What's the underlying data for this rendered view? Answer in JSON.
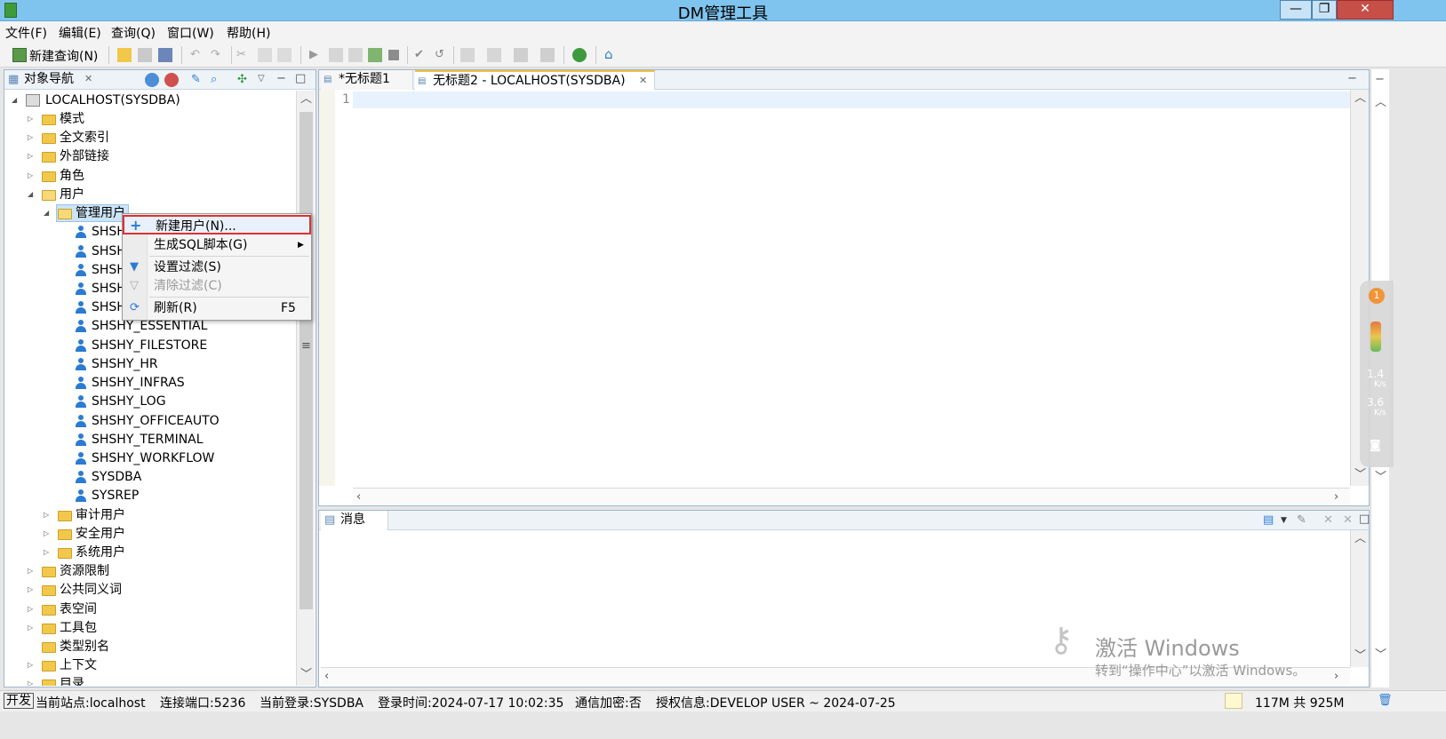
{
  "window": {
    "title": "DM管理工具",
    "minimize": "—",
    "maximize": "❐",
    "close": "✕"
  },
  "menu": [
    "文件(F)",
    "编辑(E)",
    "查询(Q)",
    "窗口(W)",
    "帮助(H)"
  ],
  "toolbar": {
    "new_query": "新建查询(N)"
  },
  "navigator": {
    "tab_label": "对象导航",
    "root": "LOCALHOST(SYSDBA)",
    "schema": "模式",
    "fulltext": "全文索引",
    "external_link": "外部链接",
    "role": "角色",
    "users": "用户",
    "admin_users": "管理用户",
    "user_items": [
      "SHSH",
      "SHSH",
      "SHSH",
      "SHSH",
      "SHSH",
      "SHSHY_ESSENTIAL",
      "SHSHY_FILESTORE",
      "SHSHY_HR",
      "SHSHY_INFRAS",
      "SHSHY_LOG",
      "SHSHY_OFFICEAUTO",
      "SHSHY_TERMINAL",
      "SHSHY_WORKFLOW",
      "SYSDBA",
      "SYSREP"
    ],
    "audit_users": "审计用户",
    "security_users": "安全用户",
    "system_users": "系统用户",
    "resource_limit": "资源限制",
    "public_synonym": "公共同义词",
    "tablespace": "表空间",
    "package": "工具包",
    "type_alias": "类型别名",
    "context": "上下文",
    "directory": "目录"
  },
  "context_menu": {
    "new_user": "新建用户(N)...",
    "gen_sql": "生成SQL脚本(G)",
    "set_filter": "设置过滤(S)",
    "clear_filter": "清除过滤(C)",
    "refresh": "刷新(R)",
    "refresh_key": "F5"
  },
  "editor": {
    "tab1": "*无标题1",
    "tab2": "无标题2 - LOCALHOST(SYSDBA)",
    "line_number": "1"
  },
  "messages": {
    "tab_label": "消息"
  },
  "status": {
    "mode": "开发",
    "site": "当前站点:localhost",
    "port": "连接端口:5236",
    "login": "当前登录:SYSDBA",
    "login_time": "登录时间:2024-07-17 10:02:35",
    "encryption": "通信加密:否",
    "license": "授权信息:DEVELOP USER ~ 2024-07-25",
    "memory": "117M 共 925M"
  },
  "float_widget": {
    "badge": "1",
    "up_speed": "1.4",
    "down_speed": "3.6",
    "unit": "K/s"
  },
  "watermark": {
    "line1": "激活 Windows",
    "line2": "转到“操作中心”以激活 Windows。"
  },
  "colors": {
    "titlebar": "#7fc4ee",
    "selection": "#cce4f7",
    "highlight_border": "#e03030",
    "user_icon": "#2b7bd2",
    "folder": "#f2c84b"
  }
}
